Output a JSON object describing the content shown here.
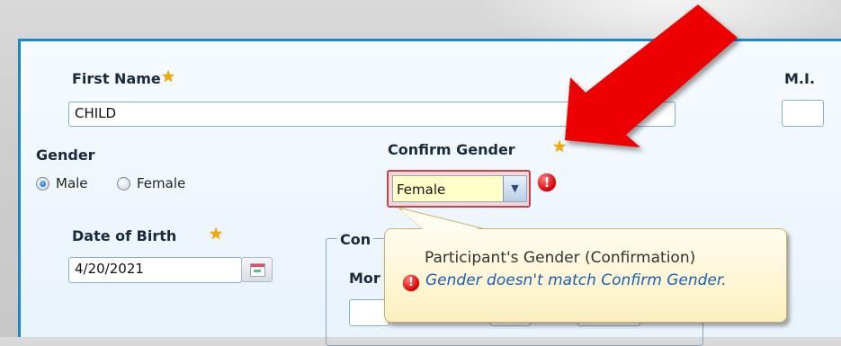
{
  "form": {
    "first_name_label": "First Name",
    "first_name_value": "CHILD",
    "mi_label": "M.I.",
    "gender_label": "Gender",
    "gender_options": [
      "Male",
      "Female"
    ],
    "gender_selected": "Male",
    "confirm_gender_label": "Confirm Gender",
    "confirm_gender_value": "Female",
    "dob_label": "Date of Birth",
    "dob_value": "4/20/2021",
    "group_title_partial": "Con",
    "group_field_partial": "Mor"
  },
  "tooltip": {
    "title": "Participant's Gender (Confirmation)",
    "message": "Gender doesn't match Confirm Gender."
  },
  "icons": {
    "required": "star-icon",
    "error": "error-icon",
    "calendar": "calendar-icon",
    "dropdown": "chevron-down-icon",
    "annotation": "red-arrow"
  },
  "colors": {
    "panel_border": "#1d86c8",
    "error": "#d60000",
    "tooltip_text_accent": "#1a5fb4",
    "required_star": "#f5a800"
  }
}
